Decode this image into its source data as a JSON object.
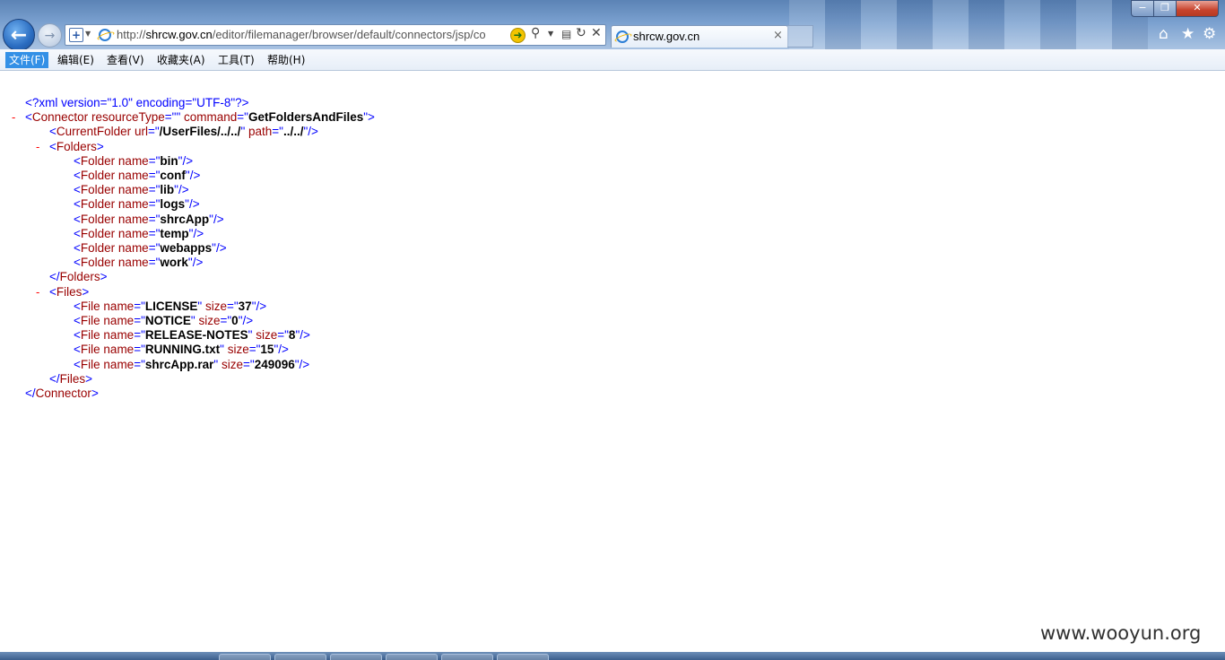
{
  "window": {
    "address": "http://shrcw.gov.cn/editor/filemanager/browser/default/connectors/jsp/co",
    "address_host_prefix": "http://",
    "address_host": "shrcw.gov.cn",
    "address_path": "/editor/filemanager/browser/default/connectors/jsp/co",
    "tab_title": "shrcw.gov.cn",
    "tab_close": "×",
    "min_icon": "−",
    "max_icon": "❐",
    "close_icon": "✕"
  },
  "menu": {
    "items": [
      "文件(F)",
      "编辑(E)",
      "查看(V)",
      "收藏夹(A)",
      "工具(T)",
      "帮助(H)"
    ],
    "active_index": 0
  },
  "xml": {
    "declaration": "<?xml version=\"1.0\" encoding=\"UTF-8\"?>",
    "connector": {
      "resourceType": "",
      "command": "GetFoldersAndFiles"
    },
    "current_folder": {
      "url": "/UserFiles/../../",
      "path": "../../"
    },
    "folders": [
      "bin",
      "conf",
      "lib",
      "logs",
      "shrcApp",
      "temp",
      "webapps",
      "work"
    ],
    "files": [
      {
        "name": "LICENSE",
        "size": "37"
      },
      {
        "name": "NOTICE",
        "size": "0"
      },
      {
        "name": "RELEASE-NOTES",
        "size": "8"
      },
      {
        "name": "RUNNING.txt",
        "size": "15"
      },
      {
        "name": "shrcApp.rar",
        "size": "249096"
      }
    ],
    "collapse_symbol": "-"
  },
  "watermark": "www.wooyun.org",
  "icons": {
    "back": "back-arrow-icon",
    "forward": "forward-arrow-icon",
    "home": "home-icon",
    "favorites": "star-icon",
    "tools": "gear-icon"
  },
  "colors": {
    "xml_tag": "#990000",
    "xml_bracket": "#0000ff",
    "xml_value": "#000000",
    "collapse": "#ff0000",
    "menu_active": "#3390e6"
  }
}
